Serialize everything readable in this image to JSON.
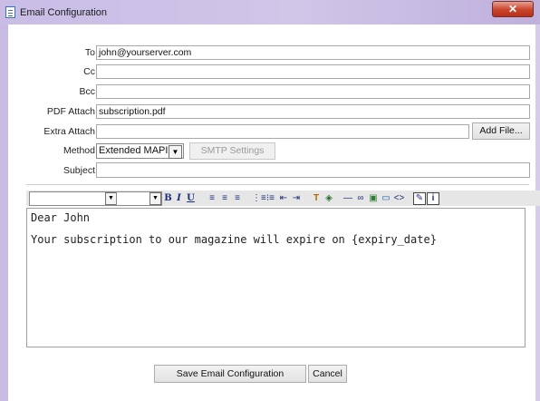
{
  "window": {
    "title": "Email Configuration",
    "close_glyph": "✕"
  },
  "form": {
    "to": {
      "label": "To",
      "value": "john@yourserver.com"
    },
    "cc": {
      "label": "Cc",
      "value": ""
    },
    "bcc": {
      "label": "Bcc",
      "value": ""
    },
    "pdf_attach": {
      "label": "PDF Attach",
      "value": "subscription.pdf"
    },
    "extra_attach": {
      "label": "Extra Attach",
      "value": "",
      "button": "Add File..."
    },
    "method": {
      "label": "Method",
      "selected": "Extended MAPI",
      "smtp_button": "SMTP Settings"
    },
    "subject": {
      "label": "Subject",
      "value": ""
    }
  },
  "toolbar": {
    "buttons": [
      {
        "id": "bold",
        "glyph": "B"
      },
      {
        "id": "italic",
        "glyph": "I"
      },
      {
        "id": "underline",
        "glyph": "U"
      },
      {
        "id": "align-left",
        "glyph": "≡"
      },
      {
        "id": "align-center",
        "glyph": "≡"
      },
      {
        "id": "align-right",
        "glyph": "≡"
      },
      {
        "id": "ordered-list",
        "glyph": "⋮≡"
      },
      {
        "id": "bullet-list",
        "glyph": "⁝≡"
      },
      {
        "id": "outdent",
        "glyph": "⇤"
      },
      {
        "id": "indent",
        "glyph": "⇥"
      },
      {
        "id": "text-color",
        "glyph": "T"
      },
      {
        "id": "highlight",
        "glyph": "◈"
      },
      {
        "id": "horizontal-rule",
        "glyph": "—"
      },
      {
        "id": "link",
        "glyph": "∞"
      },
      {
        "id": "image",
        "glyph": "▣"
      },
      {
        "id": "table",
        "glyph": "▭"
      },
      {
        "id": "source",
        "glyph": "<>"
      },
      {
        "id": "edit",
        "glyph": "✎"
      },
      {
        "id": "info",
        "glyph": "i"
      }
    ]
  },
  "editor": {
    "lines": [
      "Dear John",
      "Your subscription to our magazine will expire on {expiry_date}"
    ]
  },
  "footer": {
    "save_label": "Save Email Configuration",
    "cancel_label": "Cancel"
  },
  "colors": {
    "title_bar": "#cfc6e8",
    "close_button": "#c9442c",
    "toolbar_bg": "#e6e6e6"
  }
}
